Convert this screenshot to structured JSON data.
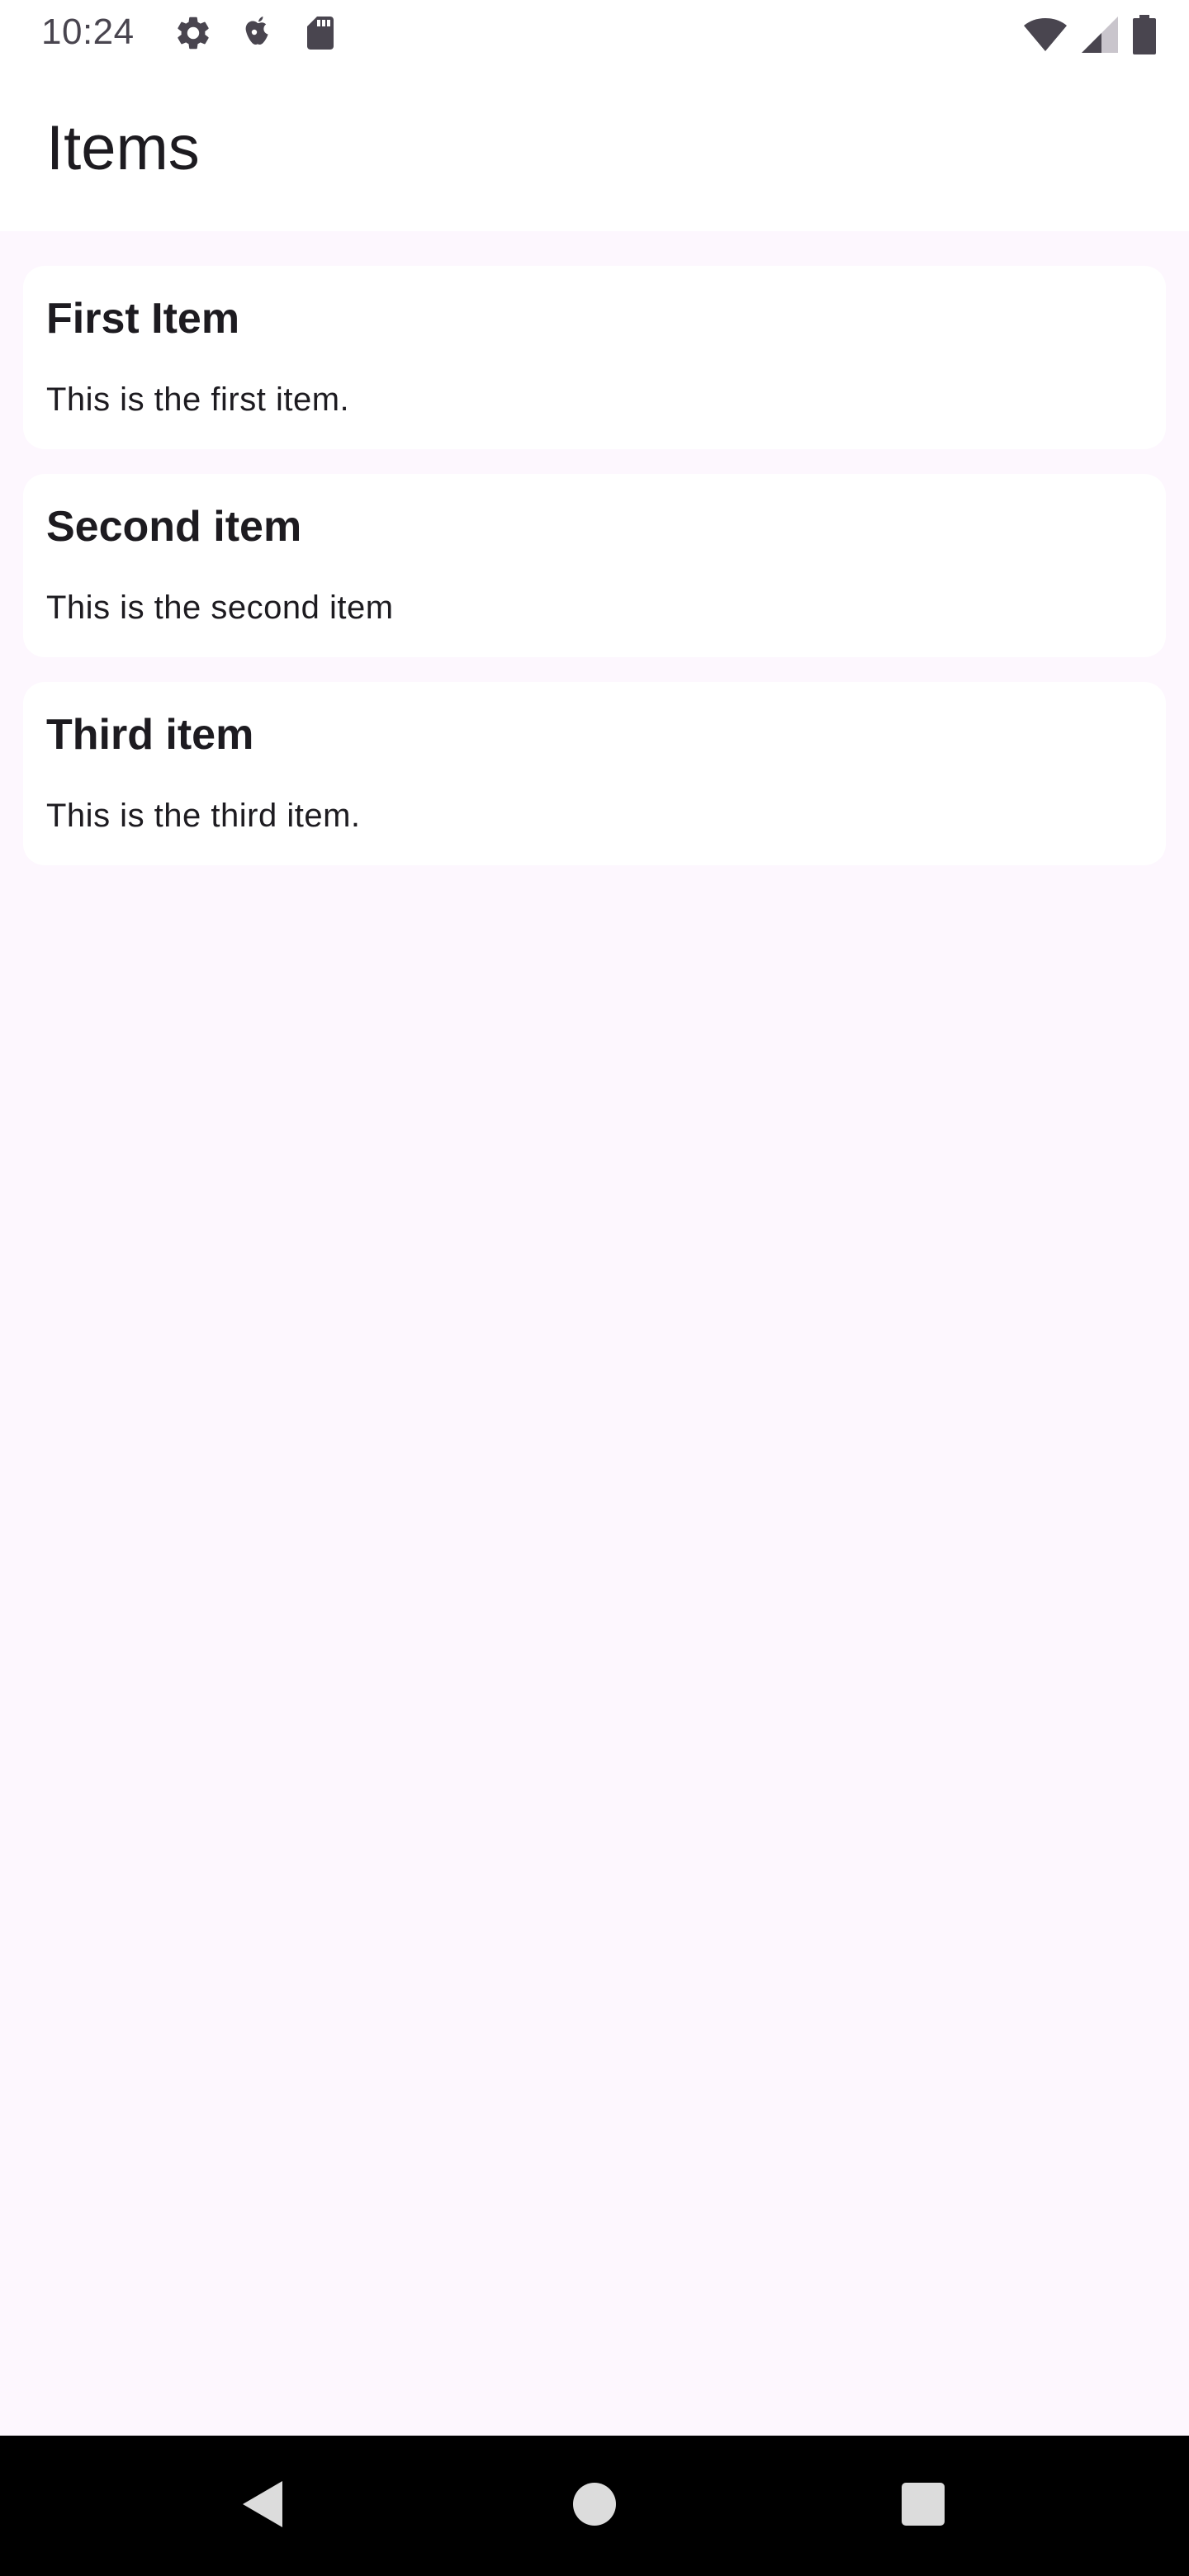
{
  "status_bar": {
    "time": "10:24",
    "left_icons": [
      "gear-icon",
      "apple-logo-icon",
      "sd-card-icon"
    ],
    "right_icons": [
      "wifi-icon",
      "cellular-signal-icon",
      "battery-icon"
    ]
  },
  "app_bar": {
    "title": "Items"
  },
  "items": [
    {
      "title": "First Item",
      "description": "This is the first item."
    },
    {
      "title": "Second item",
      "description": "This is the second item"
    },
    {
      "title": "Third item",
      "description": "This is the third item."
    }
  ],
  "nav_bar": {
    "buttons": [
      "back-button",
      "home-button",
      "recents-button"
    ]
  },
  "colors": {
    "background": "#fdf7fe",
    "surface": "#ffffff",
    "text": "#1d1b20",
    "status_text": "#49454f",
    "nav_background": "#000000"
  }
}
